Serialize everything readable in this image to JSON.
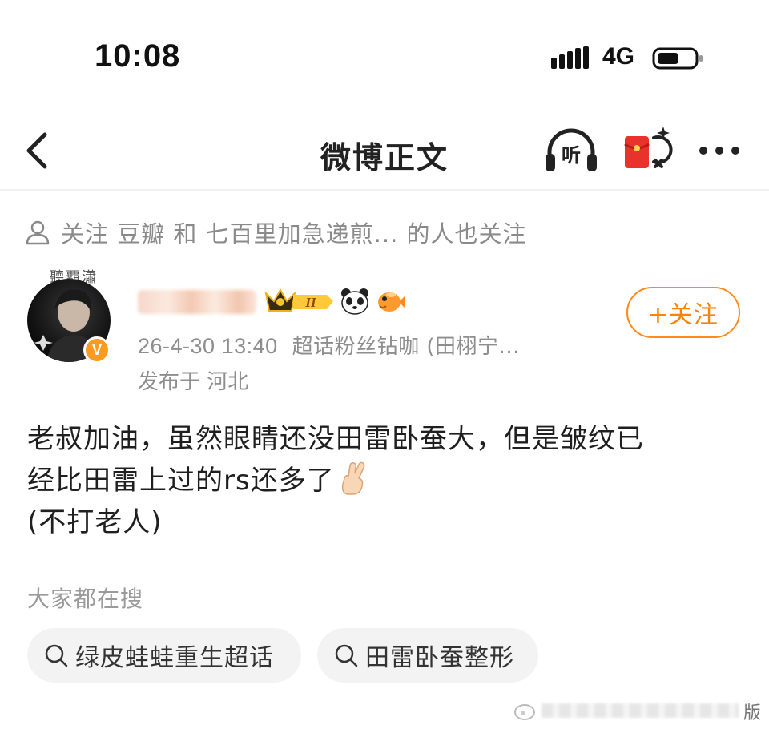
{
  "status_bar": {
    "time": "10:08",
    "network": "4G",
    "icons": [
      "signal-icon",
      "battery-icon"
    ]
  },
  "nav": {
    "title": "微博正文",
    "listen_label": "听",
    "icons": [
      "back-icon",
      "listen-icon",
      "red-packet-icon",
      "more-icon"
    ]
  },
  "follow_hint": {
    "text": "关注 豆瓣 和 七百里加急递煎... 的人也关注"
  },
  "author": {
    "avatar_deco": "聽覇瀟",
    "verified_badge": "V",
    "level_badge": "II",
    "timestamp": "26-4-30 13:40",
    "tag": "超话粉丝钻咖 (田栩宁...",
    "location": "发布于 河北",
    "follow_button": "+关注",
    "icons": [
      "crown-badge-icon",
      "panda-icon",
      "pufferfish-icon"
    ]
  },
  "post": {
    "lines": [
      "老叔加油，虽然眼睛还没田雷卧蚕大，但是皱纹已",
      "经比田雷上过的rs还多了",
      "(不打老人)"
    ],
    "emoji": "crossed-fingers-icon"
  },
  "hot_search": {
    "title": "大家都在搜",
    "items": [
      "绿皮蛙蛙重生超话",
      "田雷卧蚕整形"
    ]
  },
  "watermark": {
    "suffix": "版"
  },
  "colors": {
    "accent_orange": "#ff8200",
    "muted_text": "#8e8e8e",
    "chip_bg": "#f3f3f3"
  }
}
